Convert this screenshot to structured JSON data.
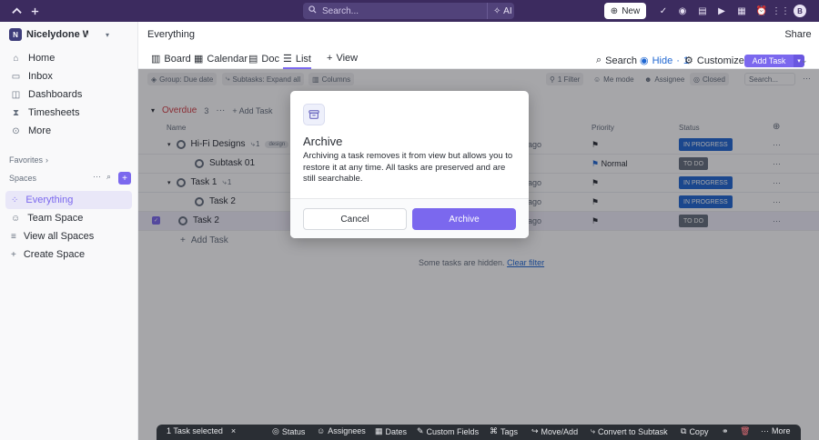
{
  "topbar": {
    "search_placeholder": "Search...",
    "ai_label": "AI",
    "new_label": "New",
    "avatar_initial": "B"
  },
  "sidebar": {
    "workspace_initial": "N",
    "workspace_name": "Nicelydone Works",
    "nav": [
      {
        "label": "Home",
        "icon": "home-icon"
      },
      {
        "label": "Inbox",
        "icon": "inbox-icon"
      },
      {
        "label": "Dashboards",
        "icon": "dashboard-icon"
      },
      {
        "label": "Timesheets",
        "icon": "timesheet-icon"
      },
      {
        "label": "More",
        "icon": "more-icon"
      }
    ],
    "favorites_label": "Favorites",
    "spaces_label": "Spaces",
    "tree": [
      {
        "label": "Everything",
        "active": true
      },
      {
        "label": "Team Space"
      },
      {
        "label": "View all Spaces"
      },
      {
        "label": "Create Space"
      }
    ]
  },
  "header": {
    "breadcrumb": "Everything",
    "share_label": "Share"
  },
  "tabs": [
    {
      "label": "Board"
    },
    {
      "label": "Calendar"
    },
    {
      "label": "Doc"
    },
    {
      "label": "List",
      "active": true
    },
    {
      "label": "View"
    }
  ],
  "toolbar": {
    "search_label": "Search",
    "hide_label": "Hide",
    "hide_count": "1",
    "customize_label": "Customize",
    "add_task_label": "Add Task"
  },
  "filters": {
    "group_label": "Group: Due date",
    "subtasks_label": "Subtasks: Expand all",
    "columns_label": "Columns",
    "filter_label": "1 Filter",
    "me_mode_label": "Me mode",
    "assignee_label": "Assignee",
    "closed_label": "Closed",
    "search_placeholder": "Search..."
  },
  "list": {
    "group_name": "Overdue",
    "group_count": "3",
    "add_task_label": "Add Task",
    "columns": {
      "name": "Name",
      "due": "e",
      "priority": "Priority",
      "status": "Status"
    },
    "rows": [
      {
        "name": "Hi-Fi Designs",
        "subtask_count": "1",
        "tag": "design",
        "date": "ago",
        "priority": "",
        "status": "IN PROGRESS"
      },
      {
        "name": "Subtask 01",
        "date": "",
        "priority": "Normal",
        "status": "TO DO"
      },
      {
        "name": "Task 1",
        "subtask_count": "1",
        "date": "ago",
        "priority": "",
        "status": "IN PROGRESS"
      },
      {
        "name": "Task 2",
        "date": "ago",
        "priority": "",
        "status": "IN PROGRESS"
      },
      {
        "name": "Task 2",
        "date": "ago",
        "priority": "",
        "status": "TO DO"
      }
    ],
    "add_task_inline": "Add Task",
    "hidden_note": "Some tasks are hidden.",
    "clear_filter": "Clear filter"
  },
  "modal": {
    "title": "Archive",
    "body": "Archiving a task removes it from view but allows you to restore it at any time. All tasks are preserved and are still searchable.",
    "cancel_label": "Cancel",
    "archive_label": "Archive"
  },
  "bulkbar": {
    "selected_label": "1 Task selected",
    "items": [
      "Status",
      "Assignees",
      "Dates",
      "Custom Fields",
      "Tags",
      "Move/Add",
      "Convert to Subtask",
      "Copy",
      "More"
    ]
  },
  "colors": {
    "accent": "#7b68ee",
    "topbar": "#3c2b5f",
    "in_progress": "#1f67d2",
    "to_do": "#656f7d",
    "overdue": "#d33d44"
  }
}
